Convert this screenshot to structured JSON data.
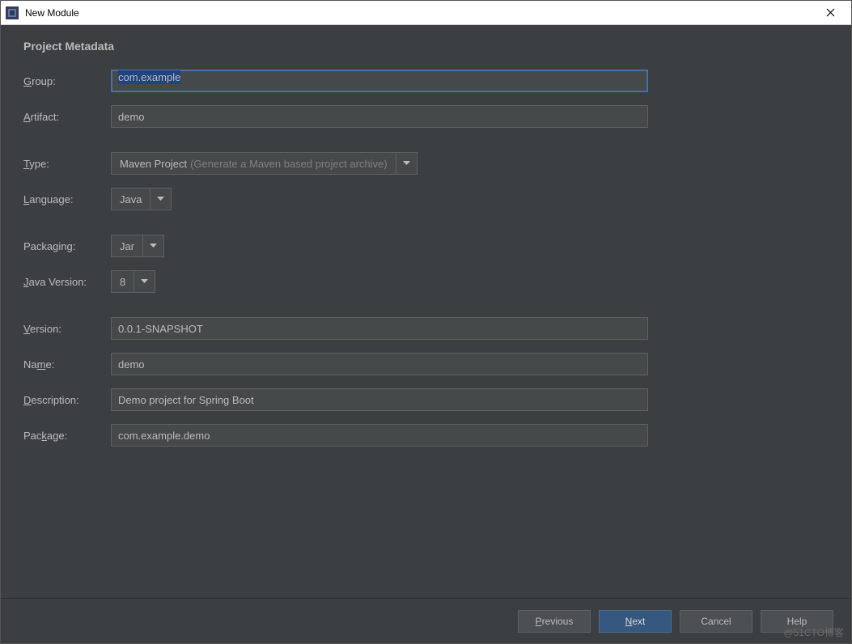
{
  "window": {
    "title": "New Module"
  },
  "section": {
    "title": "Project Metadata"
  },
  "fields": {
    "group": {
      "label_prefix": "G",
      "label_rest": "roup:",
      "value": "com.example"
    },
    "artifact": {
      "label_prefix": "A",
      "label_rest": "rtifact:",
      "value": "demo"
    },
    "type": {
      "label_prefix": "T",
      "label_rest": "ype:",
      "value": "Maven Project",
      "hint": "(Generate a Maven based project archive)"
    },
    "language": {
      "label_prefix": "L",
      "label_rest": "anguage:",
      "value": "Java"
    },
    "packaging": {
      "label_plain": "Packaging:",
      "value": "Jar"
    },
    "java_version": {
      "label_prefix": "J",
      "label_rest": "ava Version:",
      "value": "8"
    },
    "version": {
      "label_prefix": "V",
      "label_rest": "ersion:",
      "value": "0.0.1-SNAPSHOT"
    },
    "name": {
      "label_pre": "Na",
      "label_underline": "m",
      "label_post": "e:",
      "value": "demo"
    },
    "description": {
      "label_prefix": "D",
      "label_rest": "escription:",
      "value": "Demo project for Spring Boot"
    },
    "package": {
      "label_pre": "Pac",
      "label_underline": "k",
      "label_post": "age:",
      "value": "com.example.demo"
    }
  },
  "buttons": {
    "previous": {
      "prefix": "P",
      "rest": "revious"
    },
    "next": {
      "prefix": "N",
      "rest": "ext"
    },
    "cancel": "Cancel",
    "help": "Help"
  },
  "watermark": "@51CTO博客"
}
